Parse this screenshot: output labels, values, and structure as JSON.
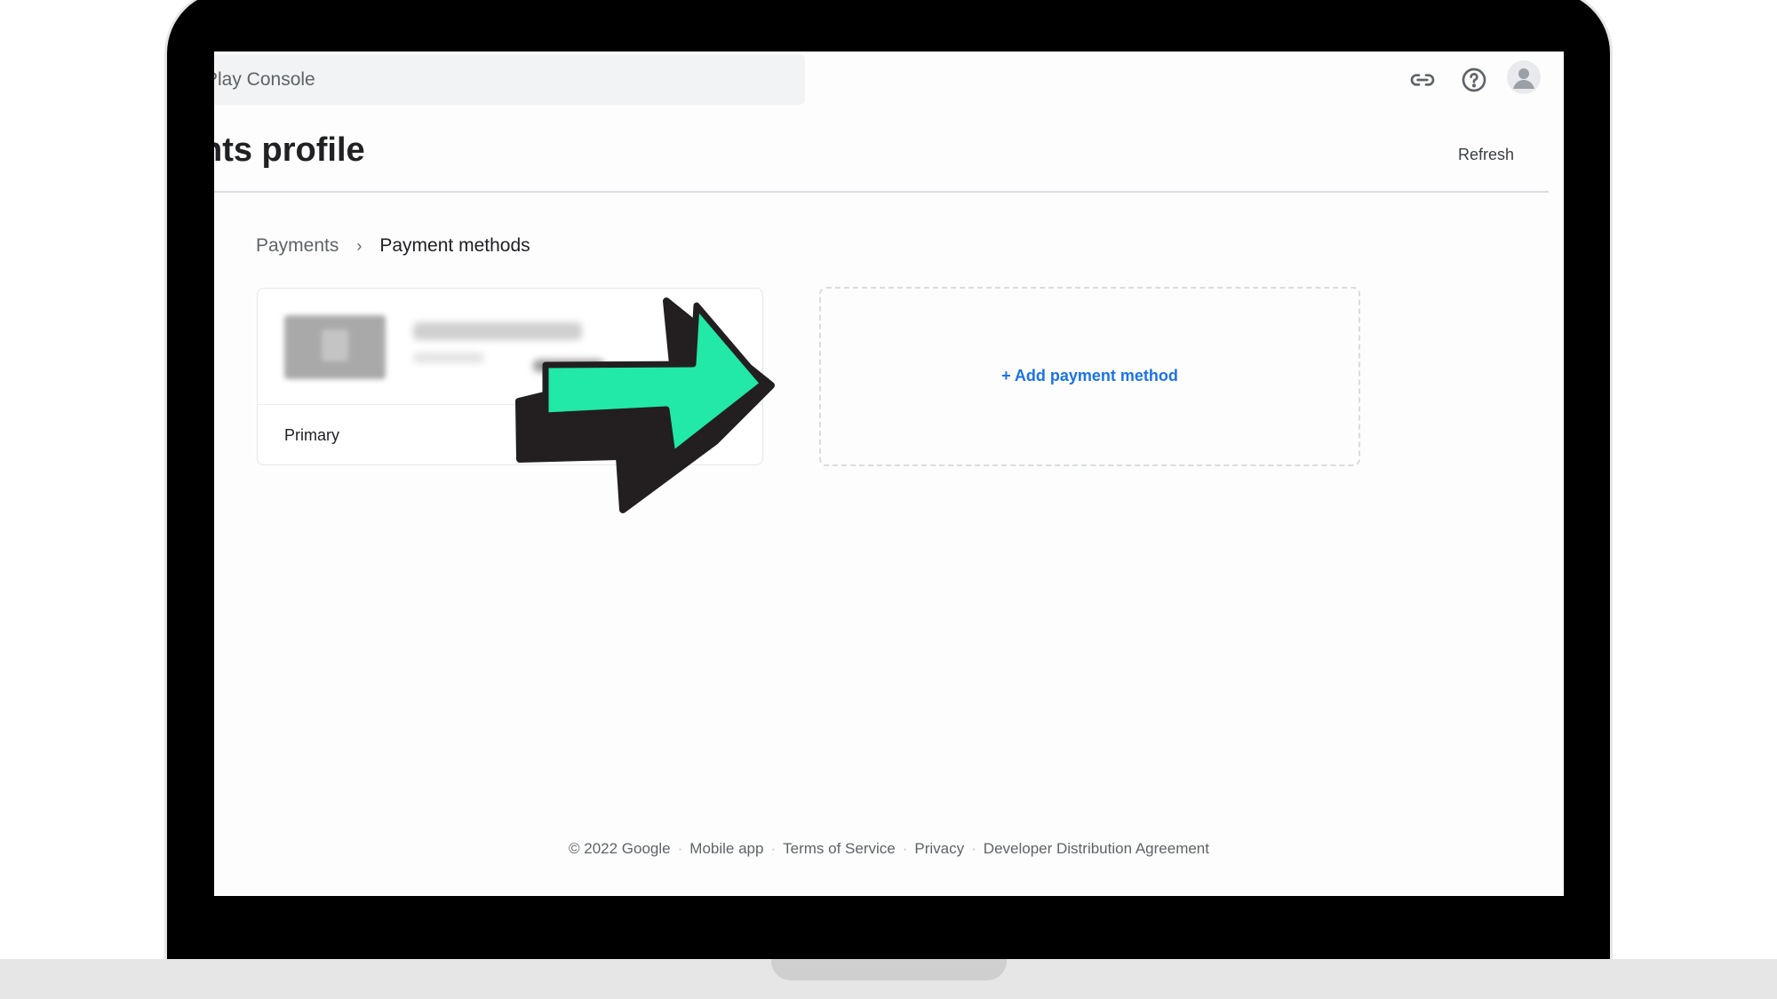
{
  "header": {
    "search_text": "Play Console",
    "icons": [
      "link-icon",
      "help-icon",
      "avatar-icon"
    ]
  },
  "page": {
    "title": "nts profile",
    "refresh_label": "Refresh"
  },
  "breadcrumb": {
    "parent": "Payments",
    "separator": "›",
    "current": "Payment methods"
  },
  "payment_card": {
    "status_label": "Primary"
  },
  "add_payment": {
    "label": "+ Add payment method"
  },
  "footer": {
    "copyright": "© 2022 Google",
    "links": [
      "Mobile app",
      "Terms of Service",
      "Privacy",
      "Developer Distribution Agreement"
    ],
    "separator": "·"
  },
  "colors": {
    "link_blue": "#1a73e8",
    "arrow_fill": "#22e8a8",
    "arrow_outline": "#231f20"
  }
}
